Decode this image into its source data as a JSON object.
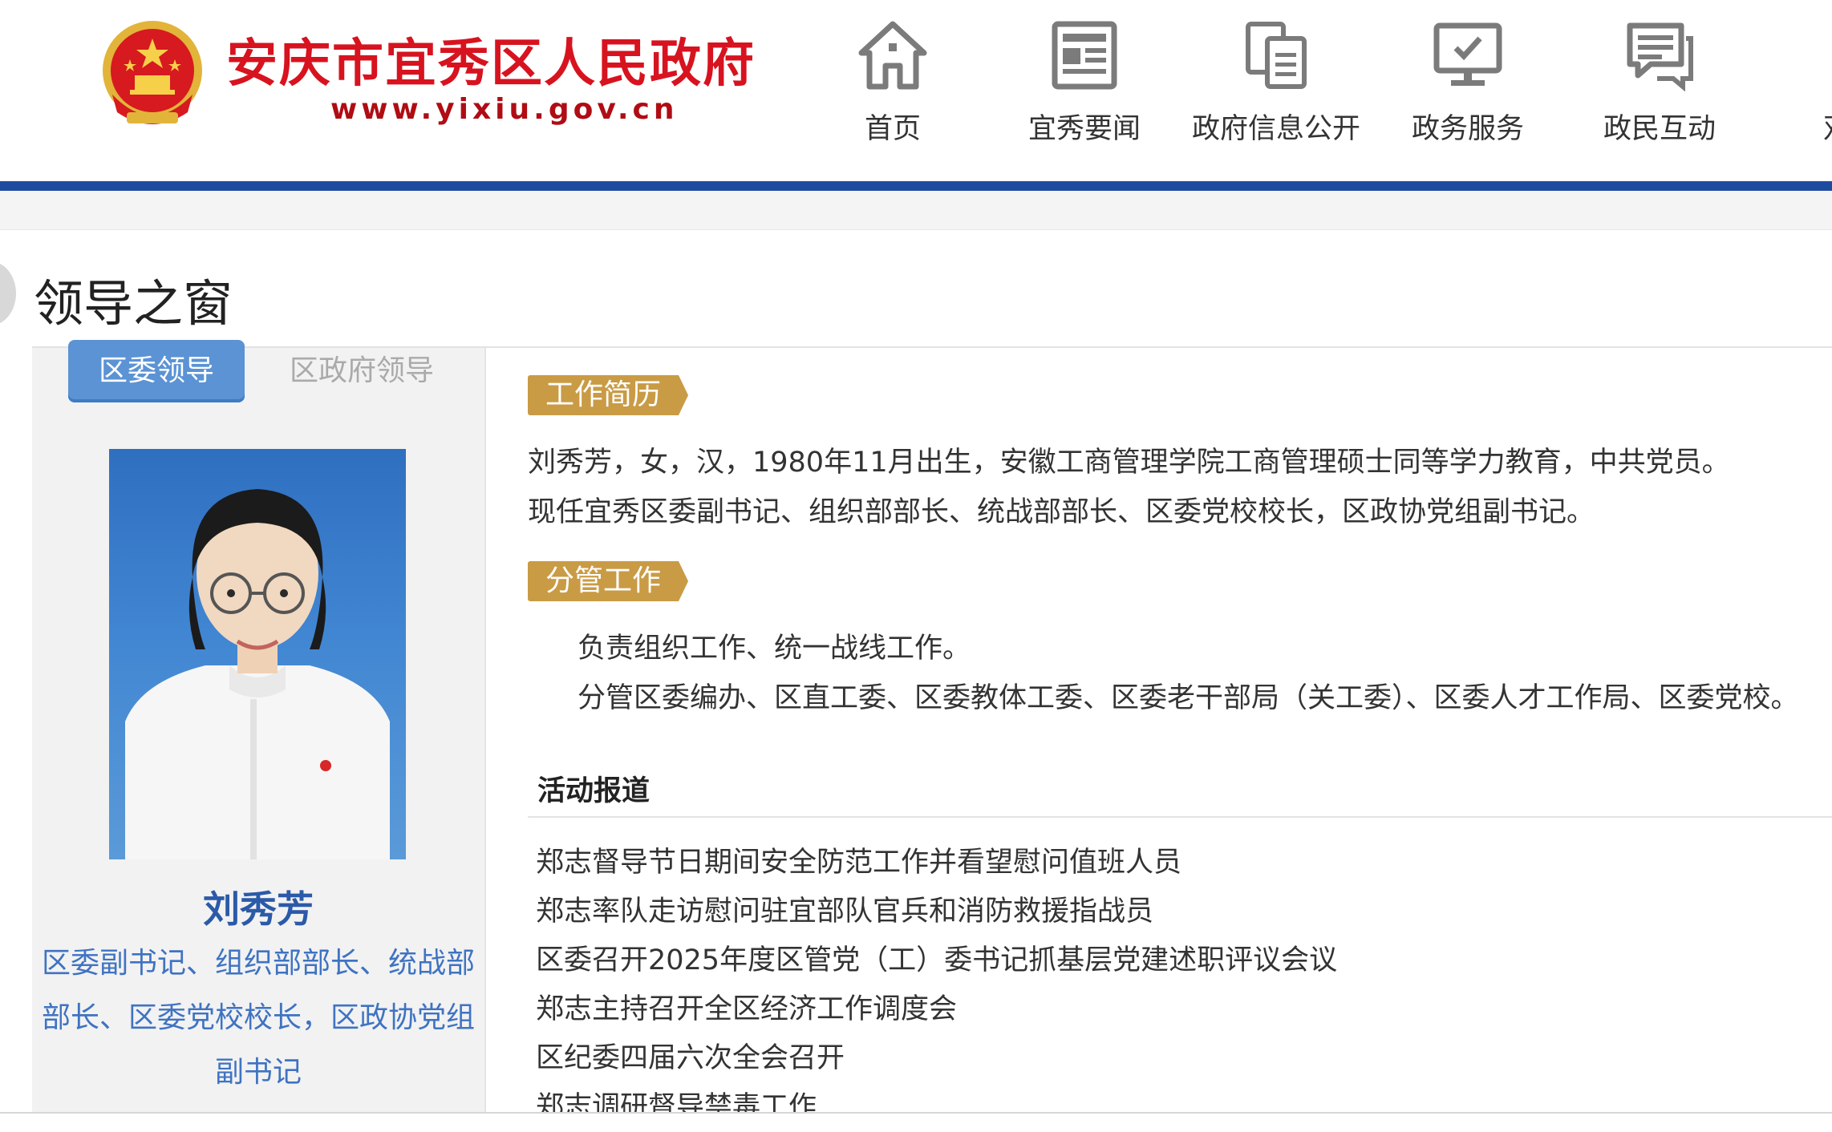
{
  "header": {
    "site_title": "安庆市宜秀区人民政府",
    "site_url": "www.yixiu.gov.cn",
    "emblem_icon": "national-emblem-icon"
  },
  "nav": {
    "items": [
      {
        "label": "首页",
        "icon": "home-icon"
      },
      {
        "label": "宜秀要闻",
        "icon": "newspaper-icon"
      },
      {
        "label": "政府信息公开",
        "icon": "documents-icon"
      },
      {
        "label": "政务服务",
        "icon": "monitor-check-icon"
      },
      {
        "label": "政民互动",
        "icon": "chat-icon"
      },
      {
        "label": "双拼",
        "icon": "building-icon"
      }
    ]
  },
  "section": {
    "title": "领导之窗"
  },
  "tabs": {
    "active": "区委领导",
    "inactive": "区政府领导"
  },
  "leader": {
    "name": "刘秀芳",
    "title": "区委副书记、组织部部长、统战部部长、区委党校校长，区政协党组副书记"
  },
  "profile": {
    "resume_tag": "工作简历",
    "resume_lines": [
      "刘秀芳，女，汉，1980年11月出生，安徽工商管理学院工商管理硕士同等学力教育，中共党员。",
      "现任宜秀区委副书记、组织部部长、统战部部长、区委党校校长，区政协党组副书记。"
    ],
    "duty_tag": "分管工作",
    "duty_lines": [
      "负责组织工作、统一战线工作。",
      "分管区委编办、区直工委、区委教体工委、区委老干部局（关工委）、区委人才工作局、区委党校。"
    ]
  },
  "news": {
    "heading": "活动报道",
    "items": [
      "郑志督导节日期间安全防范工作并看望慰问值班人员",
      "郑志率队走访慰问驻宜部队官兵和消防救援指战员",
      "区委召开2025年度区管党（工）委书记抓基层党建述职评议会议",
      "郑志主持召开全区经济工作调度会",
      "区纪委四届六次全会召开",
      "郑志调研督导禁毒工作"
    ]
  },
  "colors": {
    "title_red": "#d7131f",
    "nav_bar_blue": "#1e4ba0",
    "tab_blue": "#5b93d4",
    "tag_gold": "#c99b45",
    "leader_blue": "#2b5aa8"
  }
}
